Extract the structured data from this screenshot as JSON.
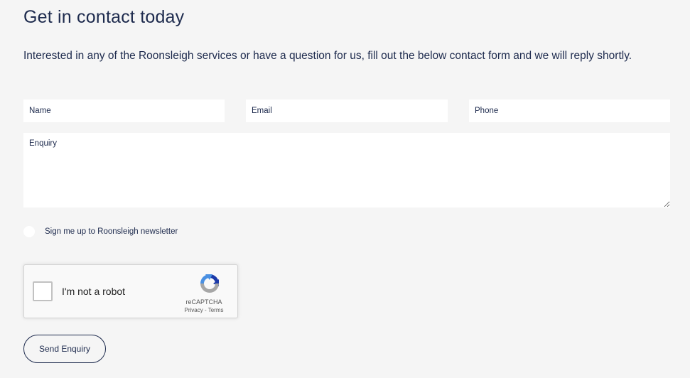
{
  "heading": "Get in contact today",
  "intro": "Interested in any of the Roonsleigh services or have a question for us, fill out the below contact form and we will reply shortly.",
  "form": {
    "name_placeholder": "Name",
    "email_placeholder": "Email",
    "phone_placeholder": "Phone",
    "enquiry_placeholder": "Enquiry",
    "newsletter_label": "Sign me up to Roonsleigh newsletter",
    "submit_label": "Send Enquiry"
  },
  "captcha": {
    "checkbox_label": "I'm not a robot",
    "brand": "reCAPTCHA",
    "privacy_label": "Privacy",
    "terms_label": "Terms",
    "separator": " - ",
    "icon": "recaptcha-logo-icon"
  },
  "colors": {
    "background": "#f5f5f5",
    "text": "#1d2a4d",
    "field_background": "#ffffff"
  }
}
